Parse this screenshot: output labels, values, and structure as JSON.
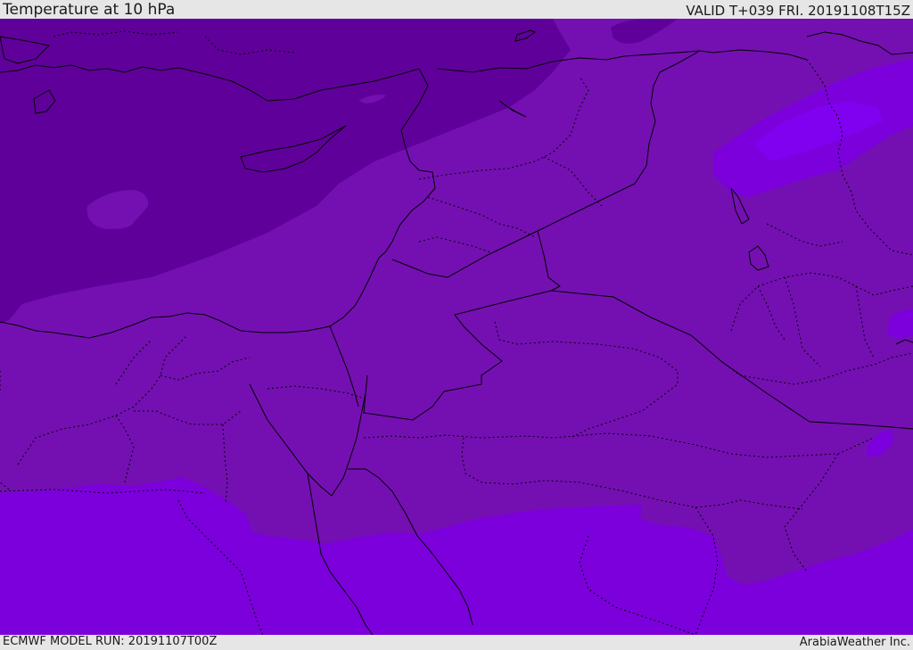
{
  "header": {
    "title": "Temperature at 10 hPa",
    "valid": "VALID T+039 FRI. 20191108T15Z"
  },
  "footer": {
    "model_run": "ECMWF MODEL RUN: 20191107T00Z",
    "credit": "ArabiaWeather Inc."
  },
  "map": {
    "field": "Temperature at 10 hPa",
    "colors": {
      "coldest": "#60009a",
      "middle": "#7410b2",
      "warmest": "#7b00dc",
      "patch": "#8000f0",
      "boundary": "#000000"
    }
  }
}
